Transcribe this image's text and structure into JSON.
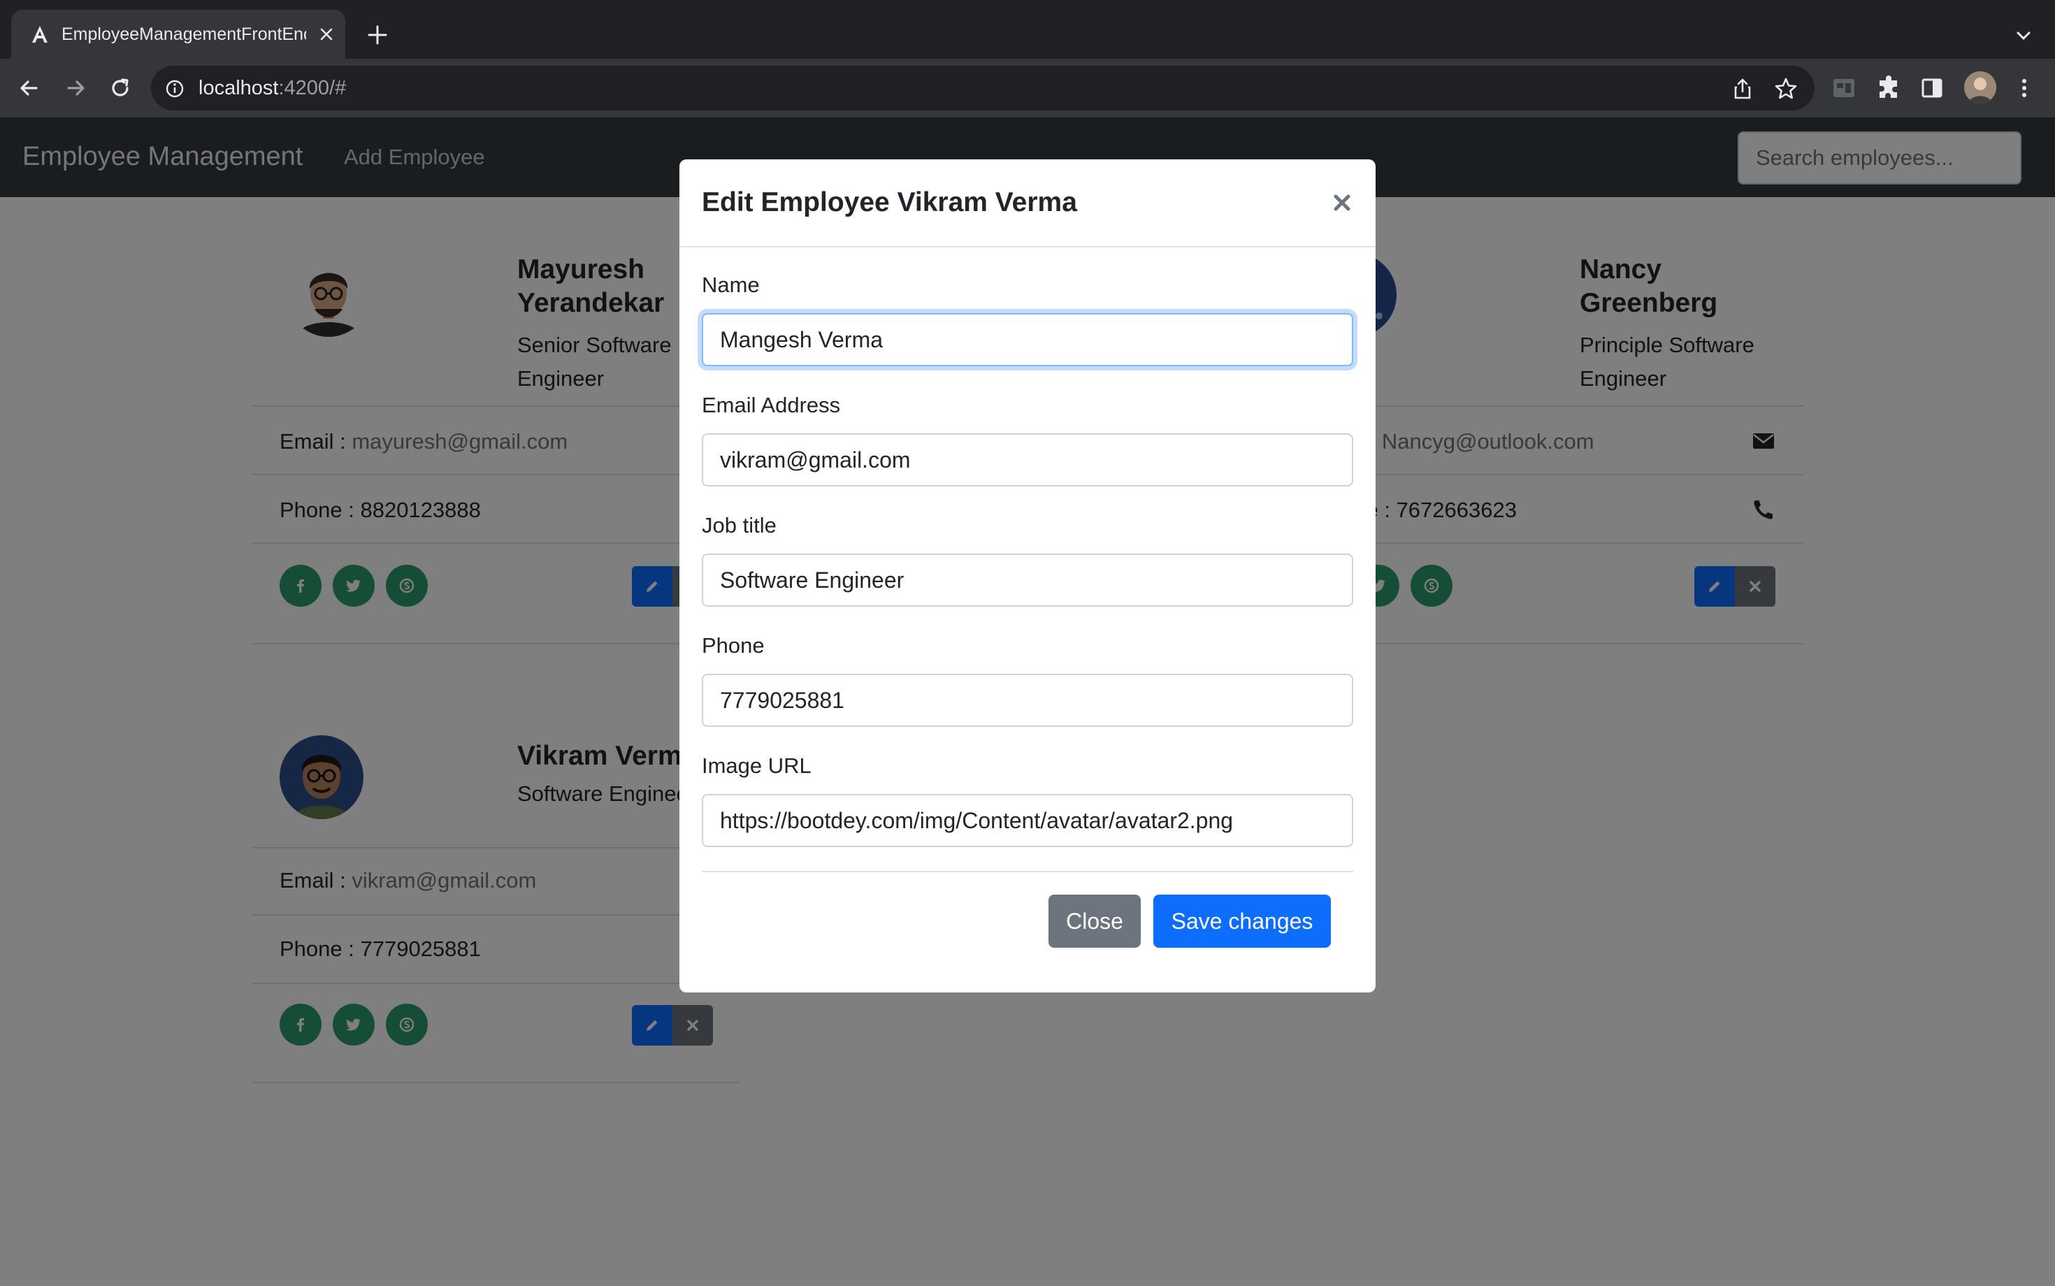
{
  "browser": {
    "tab_title": "EmployeeManagementFrontEnd",
    "url_host": "localhost",
    "url_path": ":4200/#"
  },
  "navbar": {
    "brand": "Employee Management",
    "add_link": "Add Employee",
    "search_placeholder": "Search employees..."
  },
  "labels": {
    "email": "Email : ",
    "phone": "Phone : "
  },
  "employees": [
    {
      "name_line1": "Mayuresh",
      "name_line2": "Yerandekar",
      "title_line1": "Senior Software",
      "title_line2": "Engineer",
      "email": "mayuresh@gmail.com",
      "phone": "8820123888"
    },
    {
      "name_line1": "Nancy",
      "name_line2": "Greenberg",
      "title_line1": "Principle Software",
      "title_line2": "Engineer",
      "email_prefix": "ail : ",
      "email": "Nancyg@outlook.com",
      "phone_prefix": "one : ",
      "phone": "7672663623"
    },
    {
      "name": "Vikram Verma",
      "title": "Software Engineer",
      "email": "vikram@gmail.com",
      "phone": "7779025881"
    }
  ],
  "modal": {
    "title": "Edit Employee Vikram Verma",
    "fields": {
      "name": {
        "label": "Name",
        "value": "Mangesh Verma"
      },
      "email": {
        "label": "Email Address",
        "value": "vikram@gmail.com"
      },
      "job": {
        "label": "Job title",
        "value": "Software Engineer"
      },
      "phone": {
        "label": "Phone",
        "value": "7779025881"
      },
      "image": {
        "label": "Image URL",
        "value": "https://bootdey.com/img/Content/avatar/avatar2.png"
      }
    },
    "close_label": "Close",
    "save_label": "Save changes"
  },
  "colors": {
    "primary": "#0d6efd",
    "secondary": "#6c757d",
    "social": "#2a9a6e",
    "navbar": "#343a40"
  },
  "icons": [
    "angular-icon",
    "close-icon",
    "plus-icon",
    "chevron-down-icon",
    "back-arrow-icon",
    "forward-arrow-icon",
    "reload-icon",
    "info-icon",
    "share-icon",
    "star-icon",
    "extensions-icon",
    "sidebar-icon",
    "menu-dots-icon",
    "facebook-icon",
    "twitter-icon",
    "skype-icon",
    "pencil-icon",
    "envelope-icon",
    "phone-icon"
  ]
}
